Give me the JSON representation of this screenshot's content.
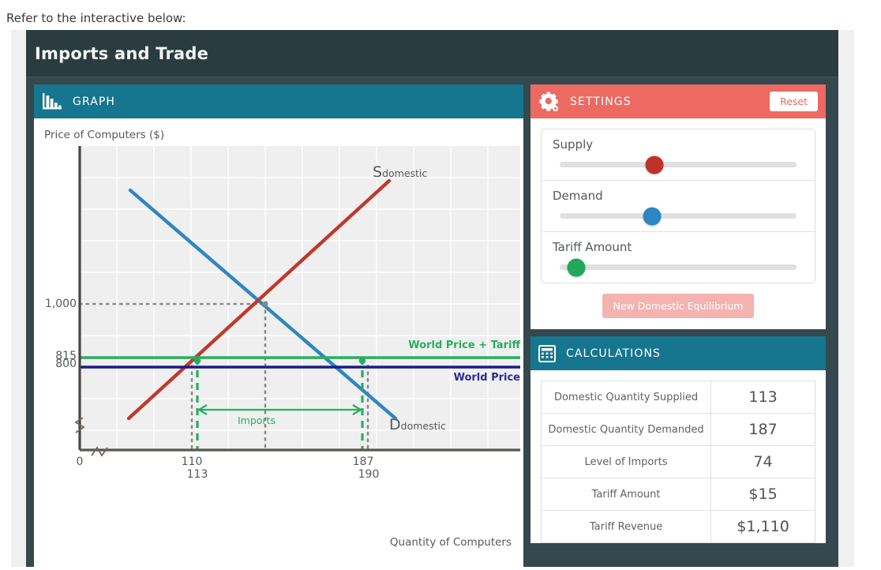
{
  "intro_text": "Refer to the interactive below:",
  "app": {
    "title": "Imports and Trade"
  },
  "graph_panel": {
    "icon": "bar-chart-icon",
    "title": "GRAPH"
  },
  "settings_panel": {
    "icon": "gear-icon",
    "title": "SETTINGS",
    "reset_label": "Reset",
    "sliders": [
      {
        "label": "Supply",
        "color": "#bf3228",
        "percent": 40
      },
      {
        "label": "Demand",
        "color": "#2e86c1",
        "percent": 39
      },
      {
        "label": "Tariff Amount",
        "color": "#21a85a",
        "percent": 7
      }
    ],
    "equilibrium_button": "New Domestic Equilibrium"
  },
  "calculations_panel": {
    "icon": "calculator-icon",
    "title": "CALCULATIONS",
    "rows": [
      {
        "label": "Domestic Quantity Supplied",
        "value": "113"
      },
      {
        "label": "Domestic Quantity Demanded",
        "value": "187"
      },
      {
        "label": "Level of Imports",
        "value": "74"
      },
      {
        "label": "Tariff Amount",
        "value": "$15"
      },
      {
        "label": "Tariff Revenue",
        "value": "$1,110"
      }
    ]
  },
  "chart_data": {
    "type": "line",
    "title": "",
    "ylabel": "Price of Computers ($)",
    "xlabel": "Quantity of Computers",
    "grid": true,
    "axis_break": true,
    "xlim": [
      0,
      260
    ],
    "ylim": [
      690,
      1180
    ],
    "x_ticks": [
      {
        "value": 0,
        "label": "0"
      },
      {
        "value": 110,
        "label": "110"
      },
      {
        "value": 113,
        "label": "113"
      },
      {
        "value": 187,
        "label": "187"
      },
      {
        "value": 190,
        "label": "190"
      }
    ],
    "y_ticks": [
      {
        "value": 1000,
        "label": "1,000"
      },
      {
        "value": 815,
        "label": "815"
      },
      {
        "value": 800,
        "label": "800"
      }
    ],
    "series": [
      {
        "name": "S_domestic",
        "label": "S",
        "sublabel": "domestic",
        "color": "#c0392b",
        "type": "supply-line",
        "points": [
          {
            "x": 45,
            "y": 735
          },
          {
            "x": 205,
            "y": 1120
          }
        ]
      },
      {
        "name": "D_domestic",
        "label": "D",
        "sublabel": "domestic",
        "color": "#2e86c1",
        "type": "demand-line",
        "points": [
          {
            "x": 48,
            "y": 1140
          },
          {
            "x": 222,
            "y": 760
          }
        ]
      },
      {
        "name": "World Price + Tariff",
        "label": "World Price + Tariff",
        "color": "#27ae60",
        "type": "horizontal-line",
        "value": 815
      },
      {
        "name": "World Price",
        "label": "World Price",
        "color": "#1a1a8c",
        "type": "horizontal-line",
        "value": 800
      }
    ],
    "annotations": [
      {
        "name": "imports-arrow",
        "label": "Imports",
        "color": "#27ae60",
        "from_x": 113,
        "to_x": 187
      },
      {
        "name": "equilibrium-guide",
        "label": "",
        "color": "#8a8a8a",
        "y": 1000
      }
    ]
  }
}
